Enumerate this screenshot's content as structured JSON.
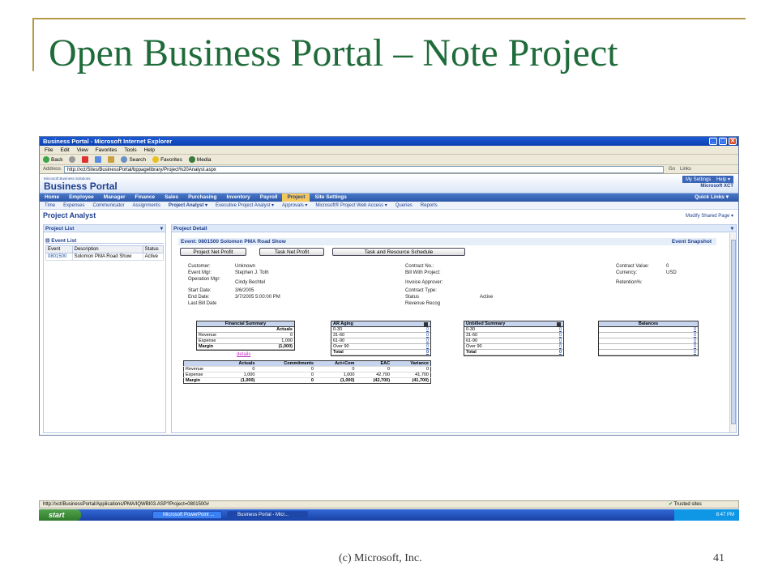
{
  "slide": {
    "title": "Open Business Portal – Note Project",
    "footer_copy": "(c) Microsoft, Inc.",
    "page_number": "41"
  },
  "browser": {
    "window_title": "Business Portal - Microsoft Internet Explorer",
    "menu": [
      "File",
      "Edit",
      "View",
      "Favorites",
      "Tools",
      "Help"
    ],
    "toolbar": [
      "Back",
      "Search",
      "Favorites",
      "Media"
    ],
    "address_label": "Address",
    "address": "http://xct/Sites/BusinessPortal/bppagelibrary/Project%20Analyst.aspx",
    "go_label": "Go",
    "links_label": "Links",
    "status_url": "http://xct/BusinessPortal/Applications/PMA/IQWBI03.ASP?Project=0801500#",
    "status_zone": "Trusted sites"
  },
  "portal": {
    "logo_small": "Microsoft Business Solutions",
    "logo": "Business Portal",
    "my_settings": "My Settings",
    "help": "Help ▾",
    "company": "Microsoft XCT",
    "nav": [
      "Home",
      "Employee",
      "Manager",
      "Finance",
      "Sales",
      "Purchasing",
      "Inventory",
      "Payroll",
      "Project",
      "Site Settings"
    ],
    "quick_links": "Quick Links ▾",
    "subnav": [
      "Time",
      "Expenses",
      "Communicator",
      "Assignments",
      "Project Analyst ▾",
      "Executive Project Analyst ▾",
      "Approvals ▾",
      "Microsoft® Project Web Access ▾",
      "Queries",
      "Reports"
    ],
    "page_title": "Project Analyst",
    "modify": "Modify Shared Page ▾"
  },
  "project_list": {
    "header": "Project List",
    "event_list_title": "Event List",
    "columns": [
      "Event",
      "Description",
      "Status"
    ],
    "rows": [
      {
        "event": "0801500",
        "description": "Solomon PMA Road Show",
        "status": "Active"
      }
    ]
  },
  "project_detail": {
    "header": "Project Detail",
    "event_title": "Event: 0801500 Solomon PMA Road Show",
    "event_snapshot": "Event Snapshot",
    "buttons": [
      "Project Net Profit",
      "Task Net Profit",
      "Task and Resource Schedule"
    ],
    "fields_left": [
      {
        "label": "Customer:",
        "value": "Unknown"
      },
      {
        "label": "Event Mgr:",
        "value": "Stephen J. Toth"
      },
      {
        "label": "Operation Mgr:",
        "value": "Cindy Bechtel"
      },
      {
        "label": "Start Date:",
        "value": "3/6/2005"
      },
      {
        "label": "End Date:",
        "value": "3/7/2005 5:00:00 PM"
      },
      {
        "label": "Last Bill Date",
        "value": ""
      }
    ],
    "fields_mid": [
      {
        "label": "Contract No.:",
        "value": ""
      },
      {
        "label": "Bill With Project:",
        "value": ""
      },
      {
        "label": "Invoice Approver:",
        "value": ""
      },
      {
        "label": "Contract Type:",
        "value": ""
      },
      {
        "label": "Status",
        "value": "Active"
      },
      {
        "label": "Revenue Recog",
        "value": ""
      }
    ],
    "fields_right": [
      {
        "label": "Contract Value:",
        "value": "0"
      },
      {
        "label": "Currency:",
        "value": "USD"
      },
      {
        "label": "Retention%:",
        "value": ""
      }
    ],
    "financial_summary": {
      "title": "Financial Summary",
      "col": "Actuals",
      "rows": [
        {
          "label": "Revenue",
          "value": "0"
        },
        {
          "label": "Expense",
          "value": "1,000"
        },
        {
          "label": "Margin",
          "value": "(1,000)"
        }
      ],
      "details": "details"
    },
    "ar_aging": {
      "title": "AR Aging",
      "rows": [
        {
          "label": "0-30",
          "value": "0"
        },
        {
          "label": "31-60",
          "value": "0"
        },
        {
          "label": "61-90",
          "value": "0"
        },
        {
          "label": "Over 90",
          "value": "0"
        },
        {
          "label": "Total",
          "value": "0"
        }
      ]
    },
    "unbilled_summary": {
      "title": "Unbilled Summary",
      "rows": [
        {
          "label": "0-30",
          "value": "0"
        },
        {
          "label": "31-60",
          "value": "0"
        },
        {
          "label": "61-90",
          "value": "0"
        },
        {
          "label": "Over 90",
          "value": "0"
        },
        {
          "label": "Total",
          "value": "0"
        }
      ]
    },
    "balances": {
      "title": "Balances",
      "rows": [
        {
          "label": "",
          "value": "0"
        },
        {
          "label": "",
          "value": "0"
        },
        {
          "label": "",
          "value": "0"
        },
        {
          "label": "",
          "value": "0"
        },
        {
          "label": "",
          "value": "0"
        }
      ]
    },
    "fin_table": {
      "columns": [
        "",
        "Actuals",
        "Commitments",
        "Act+Com",
        "EAC",
        "Variance"
      ],
      "rows": [
        [
          "Revenue",
          "0",
          "0",
          "0",
          "0",
          "0"
        ],
        [
          "Expense",
          "1,000",
          "0",
          "1,000",
          "42,700",
          "41,700"
        ],
        [
          "Margin",
          "(1,000)",
          "0",
          "(1,000)",
          "(42,700)",
          "(41,700)"
        ]
      ]
    }
  },
  "taskbar": {
    "start": "start",
    "tasks": [
      "Microsoft PowerPoint ...",
      "Business Portal - Micr..."
    ],
    "clock": "8:47 PM"
  }
}
